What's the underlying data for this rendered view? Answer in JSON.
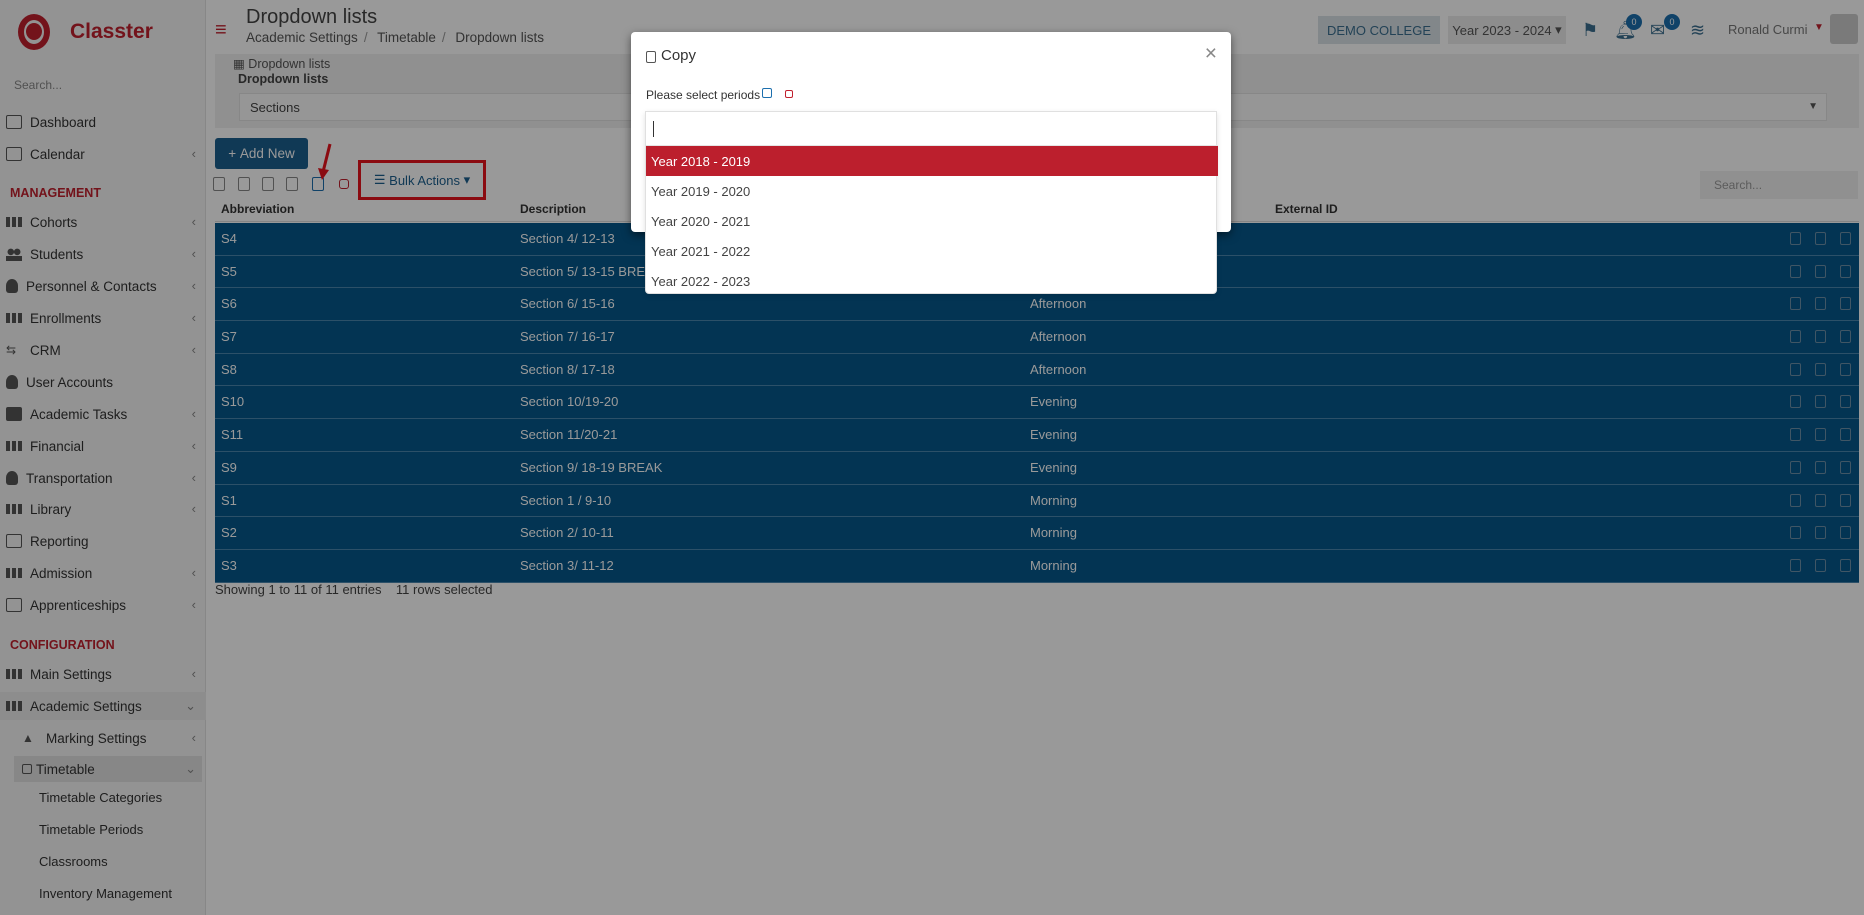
{
  "app": {
    "name": "Classter"
  },
  "sidebar": {
    "search_placeholder": "Search...",
    "items": [
      {
        "label": "Dashboard"
      },
      {
        "label": "Calendar"
      },
      {
        "label": "Cohorts"
      },
      {
        "label": "Students"
      },
      {
        "label": "Personnel & Contacts"
      },
      {
        "label": "Enrollments"
      },
      {
        "label": "CRM"
      },
      {
        "label": "User Accounts"
      },
      {
        "label": "Academic Tasks"
      },
      {
        "label": "Financial"
      },
      {
        "label": "Transportation"
      },
      {
        "label": "Library"
      },
      {
        "label": "Reporting"
      },
      {
        "label": "Admission"
      },
      {
        "label": "Apprenticeships"
      },
      {
        "label": "Main Settings"
      },
      {
        "label": "Academic Settings"
      },
      {
        "label": "Marking Settings"
      },
      {
        "label": "Timetable"
      }
    ],
    "sections": {
      "management": "MANAGEMENT",
      "configuration": "CONFIGURATION"
    },
    "subitems": [
      "Timetable Categories",
      "Timetable Periods",
      "Classrooms",
      "Inventory Management"
    ]
  },
  "header": {
    "title": "Dropdown lists",
    "breadcrumb": [
      "Academic Settings",
      "Timetable",
      "Dropdown lists"
    ],
    "college": "DEMO COLLEGE",
    "year": "Year 2023 - 2024",
    "notifications_count": "0",
    "messages_count": "0",
    "user": "Ronald Curmi"
  },
  "filter": {
    "panel_title": "Dropdown lists",
    "label": "Dropdown lists",
    "value": "Sections"
  },
  "toolbar": {
    "add_new": "Add New",
    "bulk_actions": "Bulk Actions",
    "search_placeholder": "Search..."
  },
  "table": {
    "columns": [
      "Abbreviation",
      "Description",
      "External ID"
    ],
    "rows": [
      {
        "abbr": "S4",
        "desc": "Section 4/ 12-13",
        "group": ""
      },
      {
        "abbr": "S5",
        "desc": "Section 5/ 13-15 BREAK",
        "group": ""
      },
      {
        "abbr": "S6",
        "desc": "Section 6/ 15-16",
        "group": "Afternoon"
      },
      {
        "abbr": "S7",
        "desc": "Section 7/ 16-17",
        "group": "Afternoon"
      },
      {
        "abbr": "S8",
        "desc": "Section 8/ 17-18",
        "group": "Afternoon"
      },
      {
        "abbr": "S10",
        "desc": "Section 10/19-20",
        "group": "Evening"
      },
      {
        "abbr": "S11",
        "desc": "Section 11/20-21",
        "group": "Evening"
      },
      {
        "abbr": "S9",
        "desc": "Section 9/ 18-19 BREAK",
        "group": "Evening"
      },
      {
        "abbr": "S1",
        "desc": "Section 1 / 9-10",
        "group": "Morning"
      },
      {
        "abbr": "S2",
        "desc": "Section 2/ 10-11",
        "group": "Morning"
      },
      {
        "abbr": "S3",
        "desc": "Section 3/ 11-12",
        "group": "Morning"
      }
    ],
    "info": "Showing 1 to 11 of 11 entries",
    "selected": "11 rows selected"
  },
  "modal": {
    "title": "Copy",
    "label": "Please select periods",
    "input_value": "",
    "options": [
      "Year 2018 - 2019",
      "Year 2019 - 2020",
      "Year 2020 - 2021",
      "Year 2021 - 2022",
      "Year 2022 - 2023"
    ],
    "selected_index": 0
  },
  "colors": {
    "brand": "#c0202e",
    "row": "#05578a",
    "primary_button": "#1c5f8e",
    "highlight": "#e8131d"
  }
}
